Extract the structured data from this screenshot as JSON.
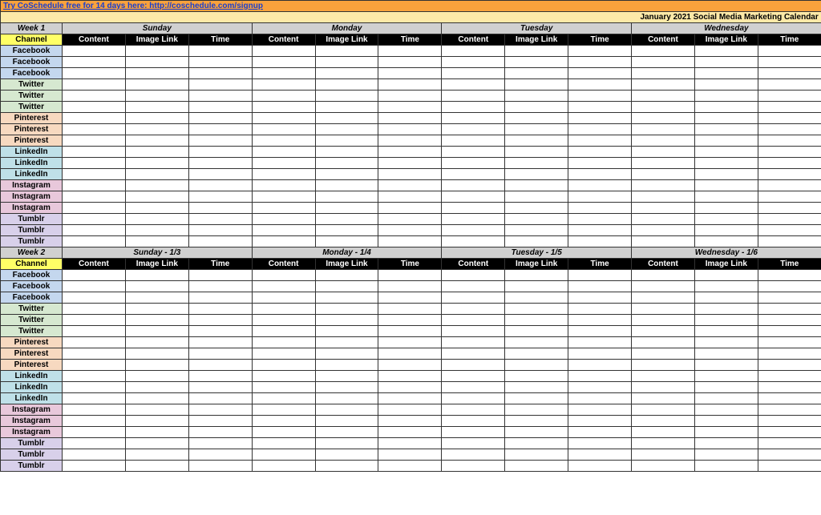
{
  "banner_text": "Try CoSchedule free for 14 days here: http://coschedule.com/signup",
  "title": "January 2021 Social Media Marketing Calendar",
  "subcols": [
    "Content",
    "Image Link",
    "Time"
  ],
  "channel_header": "Channel",
  "weeks": [
    {
      "label": "Week 1",
      "days": [
        "Sunday",
        "Monday",
        "Tuesday",
        "Wednesday"
      ],
      "tall_first": true,
      "channels": [
        {
          "name": "Facebook",
          "cls": "facebook"
        },
        {
          "name": "Facebook",
          "cls": "facebook"
        },
        {
          "name": "Facebook",
          "cls": "facebook"
        },
        {
          "name": "Twitter",
          "cls": "twitter"
        },
        {
          "name": "Twitter",
          "cls": "twitter"
        },
        {
          "name": "Twitter",
          "cls": "twitter"
        },
        {
          "name": "Pinterest",
          "cls": "pinterest"
        },
        {
          "name": "Pinterest",
          "cls": "pinterest"
        },
        {
          "name": "Pinterest",
          "cls": "pinterest"
        },
        {
          "name": "LinkedIn",
          "cls": "linkedin"
        },
        {
          "name": "LinkedIn",
          "cls": "linkedin"
        },
        {
          "name": "LinkedIn",
          "cls": "linkedin"
        },
        {
          "name": "Instagram",
          "cls": "instagram"
        },
        {
          "name": "Instagram",
          "cls": "instagram"
        },
        {
          "name": "Instagram",
          "cls": "instagram"
        },
        {
          "name": "Tumblr",
          "cls": "tumblr"
        },
        {
          "name": "Tumblr",
          "cls": "tumblr"
        },
        {
          "name": "Tumblr",
          "cls": "tumblr"
        }
      ]
    },
    {
      "label": "Week 2",
      "days": [
        "Sunday - 1/3",
        "Monday - 1/4",
        "Tuesday - 1/5",
        "Wednesday - 1/6"
      ],
      "tall_first": false,
      "channels": [
        {
          "name": "Facebook",
          "cls": "facebook"
        },
        {
          "name": "Facebook",
          "cls": "facebook"
        },
        {
          "name": "Facebook",
          "cls": "facebook"
        },
        {
          "name": "Twitter",
          "cls": "twitter"
        },
        {
          "name": "Twitter",
          "cls": "twitter"
        },
        {
          "name": "Twitter",
          "cls": "twitter"
        },
        {
          "name": "Pinterest",
          "cls": "pinterest"
        },
        {
          "name": "Pinterest",
          "cls": "pinterest"
        },
        {
          "name": "Pinterest",
          "cls": "pinterest"
        },
        {
          "name": "LinkedIn",
          "cls": "linkedin"
        },
        {
          "name": "LinkedIn",
          "cls": "linkedin"
        },
        {
          "name": "LinkedIn",
          "cls": "linkedin"
        },
        {
          "name": "Instagram",
          "cls": "instagram"
        },
        {
          "name": "Instagram",
          "cls": "instagram"
        },
        {
          "name": "Instagram",
          "cls": "instagram"
        },
        {
          "name": "Tumblr",
          "cls": "tumblr"
        },
        {
          "name": "Tumblr",
          "cls": "tumblr"
        },
        {
          "name": "Tumblr",
          "cls": "tumblr"
        }
      ]
    }
  ]
}
